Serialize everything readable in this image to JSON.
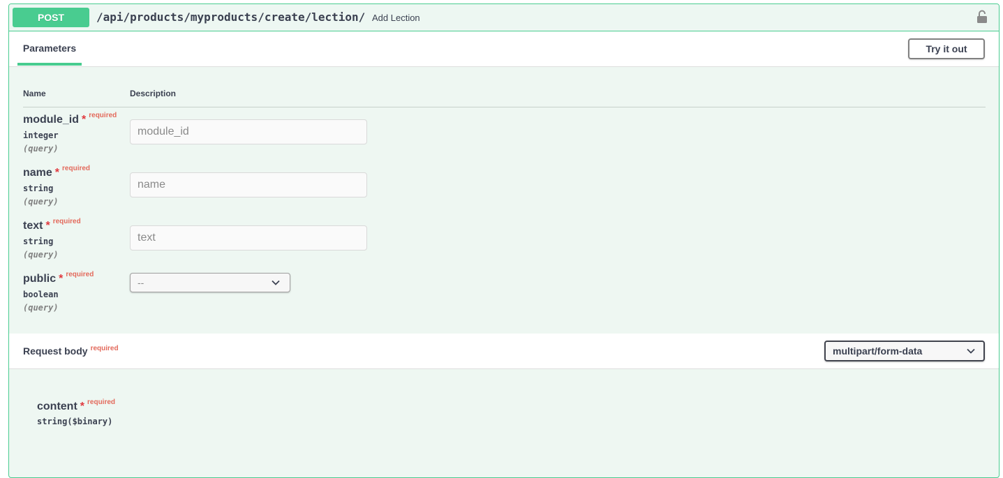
{
  "operation": {
    "method": "POST",
    "path": "/api/products/myproducts/create/lection/",
    "summary": "Add Lection",
    "lock_icon": "unlocked-padlock-icon"
  },
  "parameters_section": {
    "tab_label": "Parameters",
    "try_button_label": "Try it out",
    "col_name": "Name",
    "col_description": "Description",
    "params": [
      {
        "name": "module_id",
        "required_marker": "*",
        "required_label": "required",
        "type": "integer",
        "in": "(query)",
        "placeholder": "module_id"
      },
      {
        "name": "name",
        "required_marker": "*",
        "required_label": "required",
        "type": "string",
        "in": "(query)",
        "placeholder": "name"
      },
      {
        "name": "text",
        "required_marker": "*",
        "required_label": "required",
        "type": "string",
        "in": "(query)",
        "placeholder": "text"
      },
      {
        "name": "public",
        "required_marker": "*",
        "required_label": "required",
        "type": "boolean",
        "in": "(query)",
        "selected": "--"
      }
    ]
  },
  "request_body": {
    "title": "Request body",
    "required_label": "required",
    "content_type": "multipart/form-data",
    "field": {
      "name": "content",
      "required_marker": "*",
      "required_label": "required",
      "type": "string($binary)"
    }
  },
  "colors": {
    "post_green": "#49cc90",
    "block_bg": "#eef7f2",
    "text": "#3b4151",
    "required_red": "#e36a5c"
  }
}
